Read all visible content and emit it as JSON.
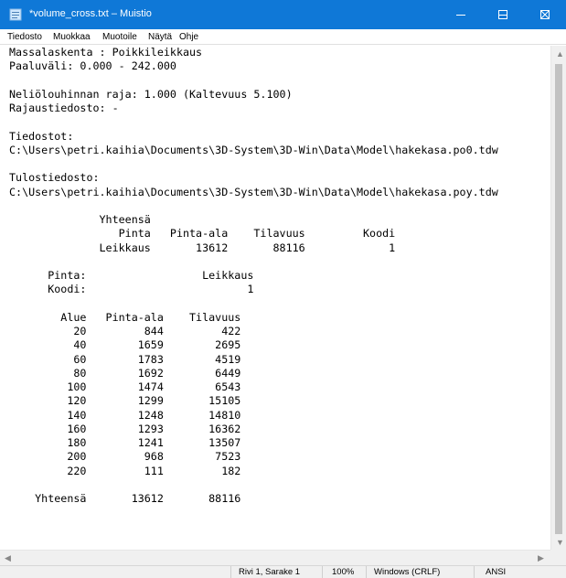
{
  "window": {
    "title": "*volume_cross.txt – Muistio"
  },
  "menu": {
    "items": [
      "Tiedosto",
      "Muokkaa",
      "Muotoile",
      "Näytä",
      "Ohje"
    ]
  },
  "editor": {
    "content": "Massalaskenta : Poikkileikkaus\nPaaluväli: 0.000 - 242.000\n\nNeliölouhinnan raja: 1.000 (Kaltevuus 5.100)\nRajaustiedosto: -\n\nTiedostot:\nC:\\Users\\petri.kaihia\\Documents\\3D-System\\3D-Win\\Data\\Model\\hakekasa.po0.tdw\n\nTulostiedosto:\nC:\\Users\\petri.kaihia\\Documents\\3D-System\\3D-Win\\Data\\Model\\hakekasa.poy.tdw\n\n              Yhteensä\n                 Pinta   Pinta-ala    Tilavuus         Koodi\n              Leikkaus       13612       88116             1\n\n      Pinta:                  Leikkaus\n      Koodi:                         1\n\n        Alue   Pinta-ala    Tilavuus\n          20         844         422\n          40        1659        2695\n          60        1783        4519\n          80        1692        6449\n         100        1474        6543\n         120        1299       15105\n         140        1248       14810\n         160        1293       16362\n         180        1241       13507\n         200         968        7523\n         220         111         182\n\n    Yhteensä       13612       88116"
  },
  "status": {
    "position": "Rivi 1, Sarake 1",
    "zoom": "100%",
    "line_ending": "Windows (CRLF)",
    "encoding": "ANSI"
  },
  "colors": {
    "titlebar": "#0f78d7",
    "statusbar": "#f0f0f0"
  }
}
